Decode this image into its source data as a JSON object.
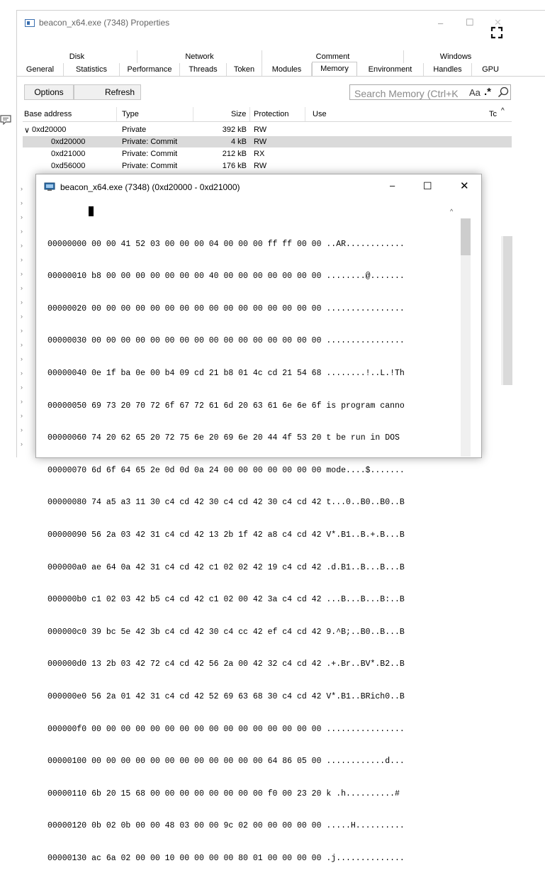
{
  "window": {
    "title": "beacon_x64.exe (7348) Properties",
    "minimize_glyph": "–",
    "maximize_glyph": "☐",
    "close_glyph": "✕"
  },
  "tabs_top": [
    {
      "label": "Disk"
    },
    {
      "label": "Network"
    },
    {
      "label": "Comment"
    },
    {
      "label": "Windows"
    }
  ],
  "tabs_bottom": [
    {
      "label": "General"
    },
    {
      "label": "Statistics"
    },
    {
      "label": "Performance"
    },
    {
      "label": "Threads"
    },
    {
      "label": "Token"
    },
    {
      "label": "Modules"
    },
    {
      "label": "Memory",
      "active": true
    },
    {
      "label": "Environment"
    },
    {
      "label": "Handles"
    },
    {
      "label": "GPU"
    }
  ],
  "toolbar": {
    "options_label": "Options",
    "refresh_label": "Refresh",
    "search_placeholder": "Search Memory (Ctrl+K)",
    "match_case_label": "Aa",
    "regex_label": ".*"
  },
  "table": {
    "columns": [
      "Base address",
      "Type",
      "Size",
      "Protection",
      "Use",
      "Tc"
    ],
    "rows": [
      {
        "base": "0xd20000",
        "type": "Private",
        "size": "392 kB",
        "prot": "RW",
        "expanded": true,
        "selected": false
      },
      {
        "base": "0xd20000",
        "type": "Private: Commit",
        "size": "4 kB",
        "prot": "RW",
        "selected": true
      },
      {
        "base": "0xd21000",
        "type": "Private: Commit",
        "size": "212 kB",
        "prot": "RX",
        "selected": false
      },
      {
        "base": "0xd56000",
        "type": "Private: Commit",
        "size": "176 kB",
        "prot": "RW",
        "selected": false
      }
    ]
  },
  "hex_window": {
    "title": "beacon_x64.exe (7348) (0xd20000 - 0xd21000)",
    "lines": [
      {
        "offset": "00000000",
        "bytes": "00 00 41 52 03 00 00 00 04 00 00 00 ff ff 00 00",
        "ascii": "..AR............"
      },
      {
        "offset": "00000010",
        "bytes": "b8 00 00 00 00 00 00 00 40 00 00 00 00 00 00 00",
        "ascii": "........@......."
      },
      {
        "offset": "00000020",
        "bytes": "00 00 00 00 00 00 00 00 00 00 00 00 00 00 00 00",
        "ascii": "................"
      },
      {
        "offset": "00000030",
        "bytes": "00 00 00 00 00 00 00 00 00 00 00 00 00 00 00 00",
        "ascii": "................"
      },
      {
        "offset": "00000040",
        "bytes": "0e 1f ba 0e 00 b4 09 cd 21 b8 01 4c cd 21 54 68",
        "ascii": "........!..L.!Th"
      },
      {
        "offset": "00000050",
        "bytes": "69 73 20 70 72 6f 67 72 61 6d 20 63 61 6e 6e 6f",
        "ascii": "is program canno"
      },
      {
        "offset": "00000060",
        "bytes": "74 20 62 65 20 72 75 6e 20 69 6e 20 44 4f 53 20",
        "ascii": "t be run in DOS "
      },
      {
        "offset": "00000070",
        "bytes": "6d 6f 64 65 2e 0d 0d 0a 24 00 00 00 00 00 00 00",
        "ascii": "mode....$......."
      },
      {
        "offset": "00000080",
        "bytes": "74 a5 a3 11 30 c4 cd 42 30 c4 cd 42 30 c4 cd 42",
        "ascii": "t...0..B0..B0..B"
      },
      {
        "offset": "00000090",
        "bytes": "56 2a 03 42 31 c4 cd 42 13 2b 1f 42 a8 c4 cd 42",
        "ascii": "V*.B1..B.+.B...B"
      },
      {
        "offset": "000000a0",
        "bytes": "ae 64 0a 42 31 c4 cd 42 c1 02 02 42 19 c4 cd 42",
        "ascii": ".d.B1..B...B...B"
      },
      {
        "offset": "000000b0",
        "bytes": "c1 02 03 42 b5 c4 cd 42 c1 02 00 42 3a c4 cd 42",
        "ascii": "...B...B...B:..B"
      },
      {
        "offset": "000000c0",
        "bytes": "39 bc 5e 42 3b c4 cd 42 30 c4 cc 42 ef c4 cd 42",
        "ascii": "9.^B;..B0..B...B"
      },
      {
        "offset": "000000d0",
        "bytes": "13 2b 03 42 72 c4 cd 42 56 2a 00 42 32 c4 cd 42",
        "ascii": ".+.Br..BV*.B2..B"
      },
      {
        "offset": "000000e0",
        "bytes": "56 2a 01 42 31 c4 cd 42 52 69 63 68 30 c4 cd 42",
        "ascii": "V*.B1..BRich0..B"
      },
      {
        "offset": "000000f0",
        "bytes": "00 00 00 00 00 00 00 00 00 00 00 00 00 00 00 00",
        "ascii": "................"
      },
      {
        "offset": "00000100",
        "bytes": "00 00 00 00 00 00 00 00 00 00 00 00 64 86 05 00",
        "ascii": "............d..."
      },
      {
        "offset": "00000110",
        "bytes": "6b 20 15 68 00 00 00 00 00 00 00 00 f0 00 23 20",
        "ascii": "k .h..........# "
      },
      {
        "offset": "00000120",
        "bytes": "0b 02 0b 00 00 48 03 00 00 9c 02 00 00 00 00 00",
        "ascii": ".....H.........."
      },
      {
        "offset": "00000130",
        "bytes": "ac 6a 02 00 00 10 00 00 00 00 80 01 00 00 00 00",
        "ascii": ".j.............."
      }
    ]
  }
}
